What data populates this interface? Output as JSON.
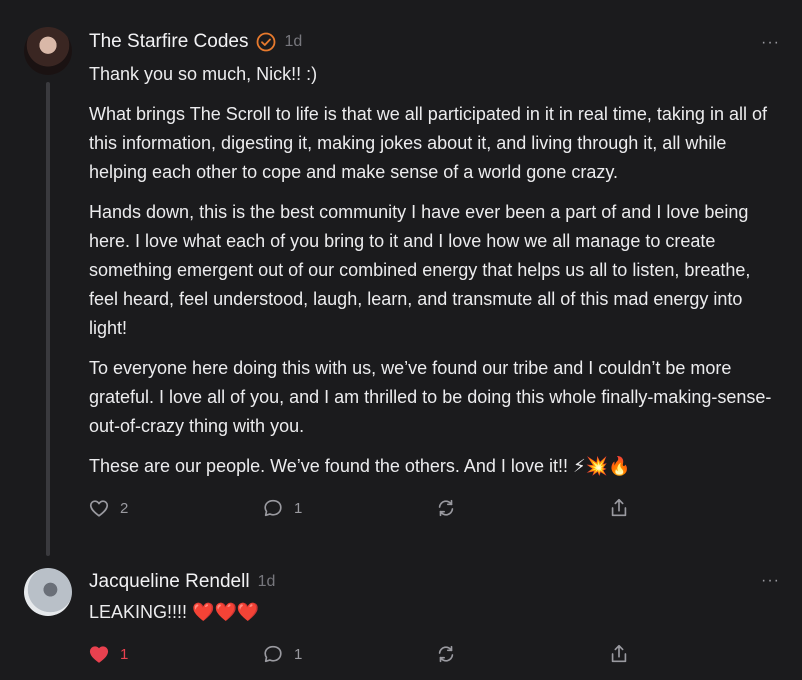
{
  "comments": [
    {
      "author": "The Starfire Codes",
      "time": "1d",
      "paragraphs": [
        "Thank you so much, Nick!! :)",
        "What brings The Scroll to life is that we all participated in it in real time, taking in all of this information, digesting it, making jokes about it, and living through it, all while helping each other to cope and make sense of a world gone crazy.",
        "Hands down, this is the best community I have ever been a part of and I love being here. I love what each of you bring to it and I love how we all manage to create something emergent out of our combined energy that helps us all to listen, breathe, feel heard, feel understood, laugh, learn, and transmute all of this mad energy into light!",
        "To everyone here doing this with us, we’ve found our tribe and I couldn’t be more grateful. I love all of you, and I am thrilled to be doing this whole finally-making-sense-out-of-crazy thing with you.",
        "These are our people. We’ve found the others. And I love it!! ⚡💥🔥"
      ],
      "likes": "2",
      "replies": "1",
      "more": "···"
    },
    {
      "author": "Jacqueline Rendell",
      "time": "1d",
      "paragraphs": [
        "LEAKING!!!! ❤️❤️❤️"
      ],
      "likes": "1",
      "replies": "1",
      "more": "···"
    }
  ],
  "colors": {
    "background": "#1b1b1d",
    "accent": "#e87a2d",
    "liked": "#e9414f"
  }
}
